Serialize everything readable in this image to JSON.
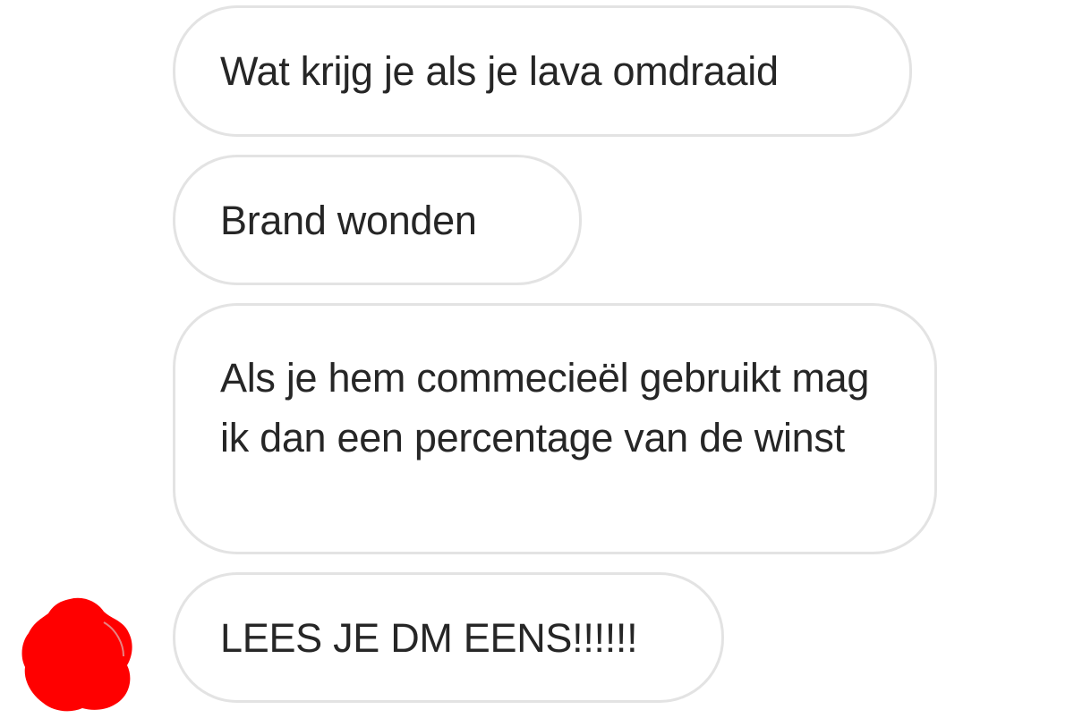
{
  "conversation": {
    "messages": [
      {
        "text": "Wat krijg je als je lava omdraaid"
      },
      {
        "text": "Brand wonden"
      },
      {
        "text": "Als je hem commecieël gebruikt mag ik dan een percentage van de winst"
      },
      {
        "text": "LEES JE DM EENS!!!!!!"
      }
    ]
  },
  "avatar": {
    "icon": "redacted-avatar-icon",
    "color": "#ff0000"
  }
}
